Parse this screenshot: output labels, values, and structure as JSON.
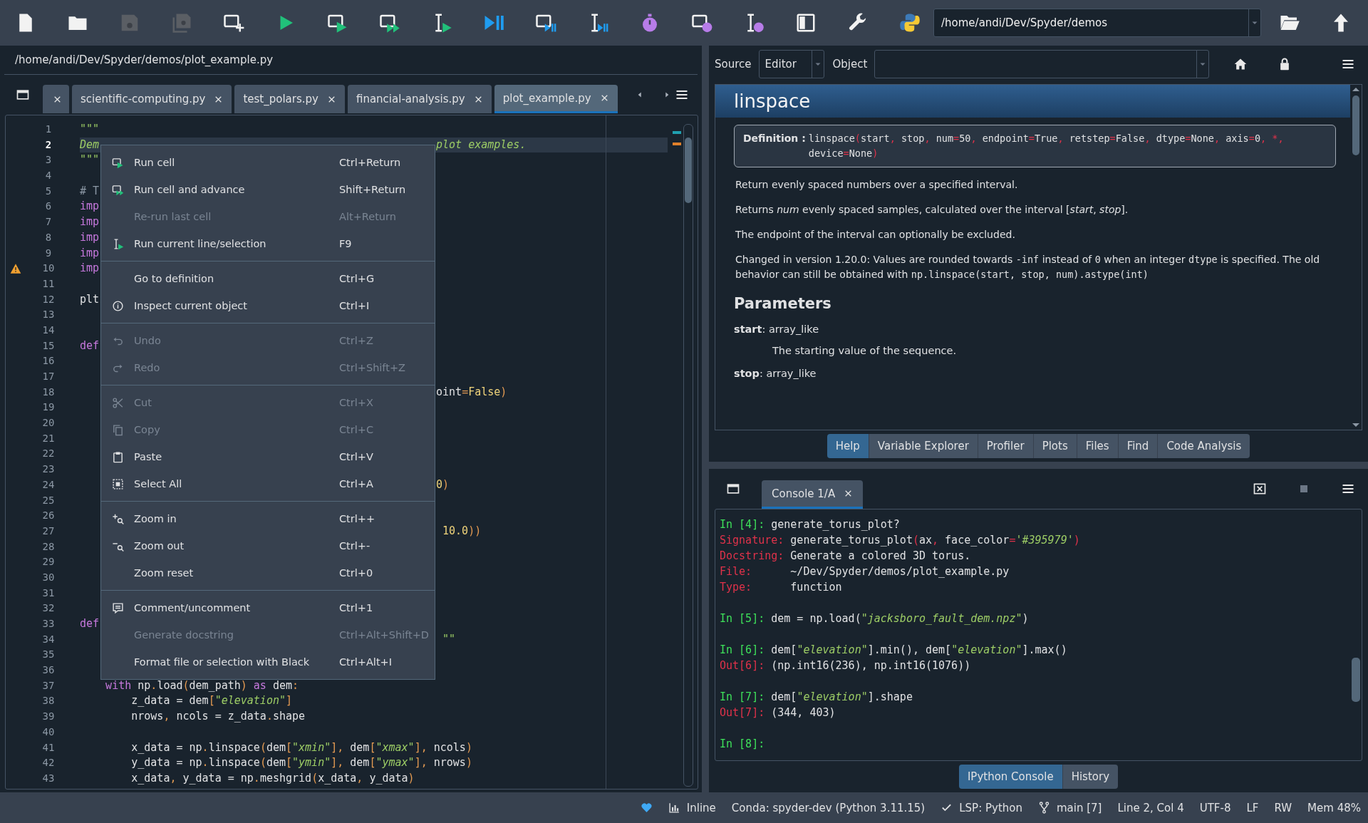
{
  "toolbar": {
    "buttons": [
      {
        "disabled": false
      },
      {
        "disabled": false
      },
      {
        "disabled": true
      },
      {
        "disabled": true
      },
      {
        "disabled": false
      },
      {
        "disabled": false
      },
      {
        "disabled": false
      },
      {
        "disabled": false
      },
      {
        "disabled": false
      },
      {
        "disabled": false
      },
      {
        "disabled": false
      },
      {
        "disabled": false
      },
      {
        "disabled": false
      },
      {
        "disabled": false
      },
      {
        "disabled": false
      },
      {
        "disabled": false
      },
      {
        "disabled": false
      },
      {
        "disabled": false
      }
    ],
    "path": "/home/andi/Dev/Spyder/demos"
  },
  "editor": {
    "file_path": "/home/andi/Dev/Spyder/demos/plot_example.py",
    "tabs": [
      {
        "selected": false
      },
      {
        "label": "scientific-computing.py",
        "selected": false
      },
      {
        "label": "test_polars.py",
        "selected": false
      },
      {
        "label": "financial-analysis.py",
        "selected": false
      },
      {
        "label": "plot_example.py",
        "selected": true
      }
    ],
    "lines": [
      {
        "number": "1",
        "current": false,
        "warning": false,
        "left": [
          {
            "text": "\"\"\"",
            "kind": "d"
          }
        ]
      },
      {
        "number": "2",
        "current": true,
        "warning": false,
        "left": [
          {
            "text": "Dem",
            "kind": "d"
          }
        ],
        "right": [
          {
            "text": "plot examples.",
            "kind": "d"
          }
        ]
      },
      {
        "number": "3",
        "current": false,
        "warning": false,
        "left": [
          {
            "text": "\"\"\"",
            "kind": "d"
          }
        ]
      },
      {
        "number": "4",
        "current": false,
        "warning": false
      },
      {
        "number": "5",
        "current": false,
        "warning": false,
        "left": [
          {
            "text": "# T",
            "kind": "c"
          }
        ]
      },
      {
        "number": "6",
        "current": false,
        "warning": false,
        "left": [
          {
            "text": "imp",
            "kind": "k"
          }
        ]
      },
      {
        "number": "7",
        "current": false,
        "warning": false,
        "left": [
          {
            "text": "imp",
            "kind": "k"
          }
        ]
      },
      {
        "number": "8",
        "current": false,
        "warning": false,
        "left": [
          {
            "text": "imp",
            "kind": "k"
          }
        ]
      },
      {
        "number": "9",
        "current": false,
        "warning": false,
        "left": [
          {
            "text": "imp",
            "kind": "k"
          }
        ]
      },
      {
        "number": "10",
        "current": false,
        "warning": true,
        "left": [
          {
            "text": "imp",
            "kind": "k"
          }
        ]
      },
      {
        "number": "11",
        "current": false,
        "warning": false
      },
      {
        "number": "12",
        "current": false,
        "warning": false,
        "left": [
          {
            "text": "plt",
            "kind": "p"
          }
        ]
      },
      {
        "number": "13",
        "current": false,
        "warning": false
      },
      {
        "number": "14",
        "current": false,
        "warning": false
      },
      {
        "number": "15",
        "current": false,
        "warning": false,
        "left": [
          {
            "text": "def",
            "kind": "k"
          }
        ]
      },
      {
        "number": "16",
        "current": false,
        "warning": false
      },
      {
        "number": "17",
        "current": false,
        "warning": false
      },
      {
        "number": "18",
        "current": false,
        "warning": false,
        "right": [
          {
            "text": "oint",
            "kind": "p"
          },
          {
            "text": "=",
            "kind": "o"
          },
          {
            "text": "False",
            "kind": "n"
          },
          {
            "text": ")",
            "kind": "o"
          }
        ]
      },
      {
        "number": "19",
        "current": false,
        "warning": false
      },
      {
        "number": "20",
        "current": false,
        "warning": false
      },
      {
        "number": "21",
        "current": false,
        "warning": false
      },
      {
        "number": "22",
        "current": false,
        "warning": false
      },
      {
        "number": "23",
        "current": false,
        "warning": false
      },
      {
        "number": "24",
        "current": false,
        "warning": false,
        "right": [
          {
            "text": "0",
            "kind": "n"
          },
          {
            "text": ")",
            "kind": "o"
          }
        ]
      },
      {
        "number": "25",
        "current": false,
        "warning": false
      },
      {
        "number": "26",
        "current": false,
        "warning": false
      },
      {
        "number": "27",
        "current": false,
        "warning": false,
        "right": [
          {
            "text": " 10.0",
            "kind": "n"
          },
          {
            "text": "))",
            "kind": "o"
          }
        ]
      },
      {
        "number": "28",
        "current": false,
        "warning": false
      },
      {
        "number": "29",
        "current": false,
        "warning": false
      },
      {
        "number": "30",
        "current": false,
        "warning": false
      },
      {
        "number": "31",
        "current": false,
        "warning": false
      },
      {
        "number": "32",
        "current": false,
        "warning": false
      },
      {
        "number": "33",
        "current": false,
        "warning": false,
        "left": [
          {
            "text": "def",
            "kind": "k"
          }
        ]
      },
      {
        "number": "34",
        "current": false,
        "warning": false,
        "right": [
          {
            "text": " \"\"",
            "kind": "d"
          }
        ]
      },
      {
        "number": "35",
        "current": false,
        "warning": false
      },
      {
        "number": "36",
        "current": false,
        "warning": false
      },
      {
        "number": "37",
        "current": false,
        "warning": false,
        "left": [
          {
            "text": "    with",
            "kind": "k"
          },
          {
            "text": " np",
            "kind": "p"
          },
          {
            "text": ".",
            "kind": "o"
          },
          {
            "text": "load",
            "kind": "p"
          },
          {
            "text": "(",
            "kind": "o"
          },
          {
            "text": "dem_path",
            "kind": "p"
          },
          {
            "text": ")",
            "kind": "o"
          },
          {
            "text": " as",
            "kind": "k"
          },
          {
            "text": " dem",
            "kind": "p"
          },
          {
            "text": ":",
            "kind": "o"
          }
        ]
      },
      {
        "number": "38",
        "current": false,
        "warning": false,
        "left": [
          {
            "text": "        z_data = dem",
            "kind": "p"
          },
          {
            "text": "[",
            "kind": "o"
          },
          {
            "text": "\"elevation\"",
            "kind": "s"
          },
          {
            "text": "]",
            "kind": "o"
          }
        ]
      },
      {
        "number": "39",
        "current": false,
        "warning": false,
        "left": [
          {
            "text": "        nrows",
            "kind": "p"
          },
          {
            "text": ",",
            "kind": "o"
          },
          {
            "text": " ncols = z_data",
            "kind": "p"
          },
          {
            "text": ".",
            "kind": "o"
          },
          {
            "text": "shape",
            "kind": "p"
          }
        ]
      },
      {
        "number": "40",
        "current": false,
        "warning": false
      },
      {
        "number": "41",
        "current": false,
        "warning": false,
        "left": [
          {
            "text": "        x_data = np",
            "kind": "p"
          },
          {
            "text": ".",
            "kind": "o"
          },
          {
            "text": "linspace",
            "kind": "p"
          },
          {
            "text": "(",
            "kind": "o"
          },
          {
            "text": "dem",
            "kind": "p"
          },
          {
            "text": "[",
            "kind": "o"
          },
          {
            "text": "\"xmin\"",
            "kind": "s"
          },
          {
            "text": "],",
            "kind": "o"
          },
          {
            "text": " dem",
            "kind": "p"
          },
          {
            "text": "[",
            "kind": "o"
          },
          {
            "text": "\"xmax\"",
            "kind": "s"
          },
          {
            "text": "],",
            "kind": "o"
          },
          {
            "text": " ncols",
            "kind": "p"
          },
          {
            "text": ")",
            "kind": "o"
          }
        ]
      },
      {
        "number": "42",
        "current": false,
        "warning": false,
        "left": [
          {
            "text": "        y_data = np",
            "kind": "p"
          },
          {
            "text": ".",
            "kind": "o"
          },
          {
            "text": "linspace",
            "kind": "p"
          },
          {
            "text": "(",
            "kind": "o"
          },
          {
            "text": "dem",
            "kind": "p"
          },
          {
            "text": "[",
            "kind": "o"
          },
          {
            "text": "\"ymin\"",
            "kind": "s"
          },
          {
            "text": "],",
            "kind": "o"
          },
          {
            "text": " dem",
            "kind": "p"
          },
          {
            "text": "[",
            "kind": "o"
          },
          {
            "text": "\"ymax\"",
            "kind": "s"
          },
          {
            "text": "],",
            "kind": "o"
          },
          {
            "text": " nrows",
            "kind": "p"
          },
          {
            "text": ")",
            "kind": "o"
          }
        ]
      },
      {
        "number": "43",
        "current": false,
        "warning": false,
        "left": [
          {
            "text": "        x_data",
            "kind": "p"
          },
          {
            "text": ",",
            "kind": "o"
          },
          {
            "text": " y_data = np",
            "kind": "p"
          },
          {
            "text": ".",
            "kind": "o"
          },
          {
            "text": "meshgrid",
            "kind": "p"
          },
          {
            "text": "(",
            "kind": "o"
          },
          {
            "text": "x_data",
            "kind": "p"
          },
          {
            "text": ",",
            "kind": "o"
          },
          {
            "text": " y_data",
            "kind": "p"
          },
          {
            "text": ")",
            "kind": "o"
          }
        ]
      }
    ]
  },
  "context_menu": {
    "sections": [
      {
        "items": [
          {
            "label": "Run cell",
            "shortcut": "Ctrl+Return",
            "disabled": false
          },
          {
            "label": "Run cell and advance",
            "shortcut": "Shift+Return",
            "disabled": false
          },
          {
            "label": "Re-run last cell",
            "shortcut": "Alt+Return",
            "disabled": true
          },
          {
            "label": "Run current line/selection",
            "shortcut": "F9",
            "disabled": false
          }
        ]
      },
      {
        "items": [
          {
            "label": "Go to definition",
            "shortcut": "Ctrl+G",
            "disabled": false
          },
          {
            "label": "Inspect current object",
            "shortcut": "Ctrl+I",
            "disabled": false
          }
        ]
      },
      {
        "items": [
          {
            "label": "Undo",
            "shortcut": "Ctrl+Z",
            "disabled": true
          },
          {
            "label": "Redo",
            "shortcut": "Ctrl+Shift+Z",
            "disabled": true
          }
        ]
      },
      {
        "items": [
          {
            "label": "Cut",
            "shortcut": "Ctrl+X",
            "disabled": true
          },
          {
            "label": "Copy",
            "shortcut": "Ctrl+C",
            "disabled": true
          },
          {
            "label": "Paste",
            "shortcut": "Ctrl+V",
            "disabled": false
          },
          {
            "label": "Select All",
            "shortcut": "Ctrl+A",
            "disabled": false
          }
        ]
      },
      {
        "items": [
          {
            "label": "Zoom in",
            "shortcut": "Ctrl++",
            "disabled": false
          },
          {
            "label": "Zoom out",
            "shortcut": "Ctrl+-",
            "disabled": false
          },
          {
            "label": "Zoom reset",
            "shortcut": "Ctrl+0",
            "disabled": false
          }
        ]
      },
      {
        "items": [
          {
            "label": "Comment/uncomment",
            "shortcut": "Ctrl+1",
            "disabled": false
          },
          {
            "label": "Generate docstring",
            "shortcut": "Ctrl+Alt+Shift+D",
            "disabled": true
          },
          {
            "label": "Format file or selection with Black",
            "shortcut": "Ctrl+Alt+I",
            "disabled": false
          }
        ]
      }
    ]
  },
  "help": {
    "source_label": "Source",
    "source": "Editor",
    "object_label": "Object",
    "title": "linspace",
    "definition_label": "Definition :",
    "definition": "linspace(start, stop, num=50, endpoint=True, retstep=False, dtype=None, axis=0, *, device=None)",
    "paragraphs": [
      {
        "segments": [
          {
            "text": "Return evenly spaced numbers over a specified interval.",
            "mono": false
          }
        ]
      },
      {
        "segments": [
          {
            "text": "Returns *num* evenly spaced samples, calculated over the interval [*start*, *stop*].",
            "mono": false
          }
        ]
      },
      {
        "segments": [
          {
            "text": "The endpoint of the interval can optionally be excluded.",
            "mono": false
          }
        ]
      },
      {
        "segments": [
          {
            "text": "Changed in version 1.20.0: Values are rounded towards ",
            "mono": false
          },
          {
            "text": "-inf",
            "mono": true
          },
          {
            "text": " instead of ",
            "mono": false
          },
          {
            "text": "0",
            "mono": true
          },
          {
            "text": " when an integer ",
            "mono": false
          },
          {
            "text": "dtype",
            "mono": true
          },
          {
            "text": " is specified. The old behavior can still be obtained with ",
            "mono": false
          },
          {
            "text": "np.linspace(start, stop, num).astype(int)",
            "mono": true
          }
        ]
      }
    ],
    "heading": "Parameters",
    "params": [
      {
        "signature": "**start**: array_like",
        "description": "The starting value of the sequence."
      },
      {
        "signature": "**stop**: array_like"
      }
    ],
    "tabs": [
      {
        "label": "Help",
        "selected": true
      },
      {
        "label": "Variable Explorer",
        "selected": false
      },
      {
        "label": "Profiler",
        "selected": false
      },
      {
        "label": "Plots",
        "selected": false
      },
      {
        "label": "Files",
        "selected": false
      },
      {
        "label": "Find",
        "selected": false
      },
      {
        "label": "Code Analysis",
        "selected": false
      }
    ]
  },
  "console": {
    "tab": "Console 1/A",
    "blocks": [
      {
        "lines": [
          {
            "tokens": [
              {
                "text": "In [4]: ",
                "kind": "in"
              },
              {
                "text": "generate_torus_plot?",
                "kind": "p"
              }
            ]
          },
          {
            "tokens": [
              {
                "text": "Signature: ",
                "kind": "label"
              },
              {
                "text": "generate_torus_plot",
                "kind": "p"
              },
              {
                "text": "(",
                "kind": "o"
              },
              {
                "text": "ax",
                "kind": "p"
              },
              {
                "text": ",",
                "kind": "o"
              },
              {
                "text": " face_color",
                "kind": "p"
              },
              {
                "text": "=",
                "kind": "o"
              },
              {
                "text": "'#395979'",
                "kind": "s"
              },
              {
                "text": ")",
                "kind": "o"
              }
            ]
          },
          {
            "tokens": [
              {
                "text": "Docstring: ",
                "kind": "label"
              },
              {
                "text": "Generate a colored 3D torus.",
                "kind": "p"
              }
            ]
          },
          {
            "tokens": [
              {
                "text": "File:      ",
                "kind": "label"
              },
              {
                "text": "~/Dev/Spyder/demos/plot_example.py",
                "kind": "p"
              }
            ]
          },
          {
            "tokens": [
              {
                "text": "Type:      ",
                "kind": "label"
              },
              {
                "text": "function",
                "kind": "p"
              }
            ]
          }
        ]
      },
      {
        "lines": [
          {
            "tokens": [
              {
                "text": "In [5]: ",
                "kind": "in"
              },
              {
                "text": "dem = np.load(",
                "kind": "p"
              },
              {
                "text": "\"jacksboro_fault_dem.npz\"",
                "kind": "s"
              },
              {
                "text": ")",
                "kind": "p"
              }
            ]
          }
        ]
      },
      {
        "lines": [
          {
            "tokens": [
              {
                "text": "In [6]: ",
                "kind": "in"
              },
              {
                "text": "dem[",
                "kind": "p"
              },
              {
                "text": "\"elevation\"",
                "kind": "s"
              },
              {
                "text": "].min(), dem[",
                "kind": "p"
              },
              {
                "text": "\"elevation\"",
                "kind": "s"
              },
              {
                "text": "].max()",
                "kind": "p"
              }
            ]
          },
          {
            "tokens": [
              {
                "text": "Out[6]: ",
                "kind": "out"
              },
              {
                "text": "(np.int16(236), np.int16(1076))",
                "kind": "p"
              }
            ]
          }
        ]
      },
      {
        "lines": [
          {
            "tokens": [
              {
                "text": "In [7]: ",
                "kind": "in"
              },
              {
                "text": "dem[",
                "kind": "p"
              },
              {
                "text": "\"elevation\"",
                "kind": "s"
              },
              {
                "text": "].shape",
                "kind": "p"
              }
            ]
          },
          {
            "tokens": [
              {
                "text": "Out[7]: ",
                "kind": "out"
              },
              {
                "text": "(344, 403)",
                "kind": "p"
              }
            ]
          }
        ]
      },
      {
        "lines": [
          {
            "tokens": [
              {
                "text": "In [8]:",
                "kind": "in"
              }
            ]
          }
        ]
      }
    ],
    "tabs": [
      {
        "label": "IPython Console",
        "selected": true
      },
      {
        "label": "History",
        "selected": false
      }
    ]
  },
  "status_bar": [
    {
      "text": "Inline"
    },
    {
      "text": "Conda: spyder-dev (Python 3.11.15)"
    },
    {
      "text": "LSP: Python"
    },
    {
      "text": "main [7]"
    },
    {
      "text": "Line 2, Col 4"
    },
    {
      "text": "UTF-8"
    },
    {
      "text": "LF"
    },
    {
      "text": "RW"
    },
    {
      "text": "Mem 48%"
    }
  ]
}
